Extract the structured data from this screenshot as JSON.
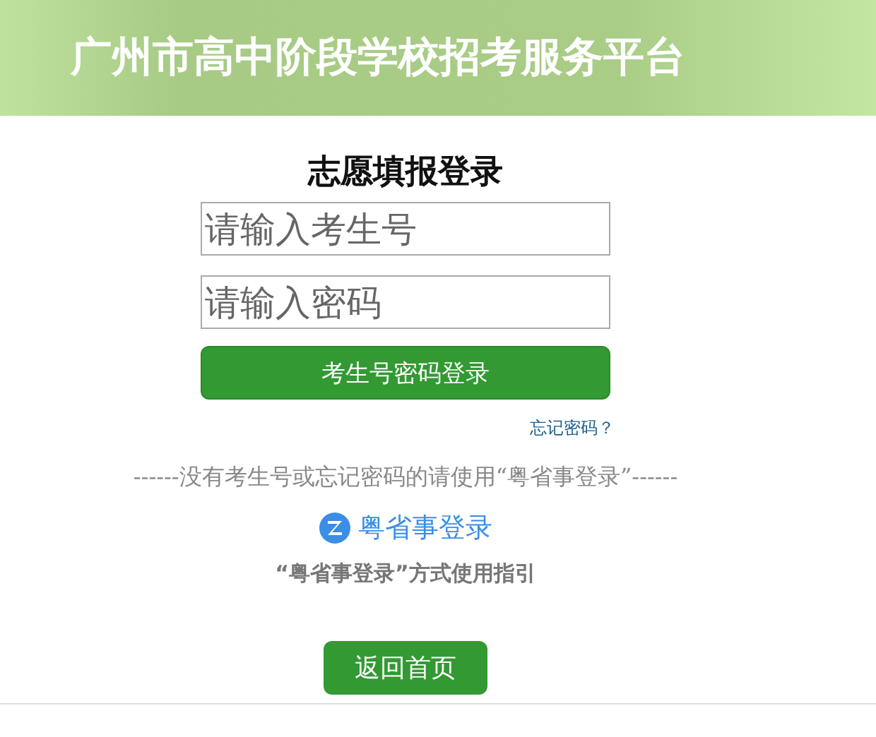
{
  "header": {
    "title": "广州市高中阶段学校招考服务平台"
  },
  "login": {
    "title": "志愿填报登录",
    "fields": [
      {
        "placeholder": "请输入考生号"
      },
      {
        "placeholder": "请输入密码"
      }
    ],
    "submit": "考生号密码登录",
    "forgot_link": "忘记密码？",
    "notice": "------没有考生号或忘记密码的请使用“粤省事登录”------",
    "alt_login": "粤省事登录",
    "guide": "“粤省事登录”方式使用指引"
  },
  "back_button": "返回首页"
}
